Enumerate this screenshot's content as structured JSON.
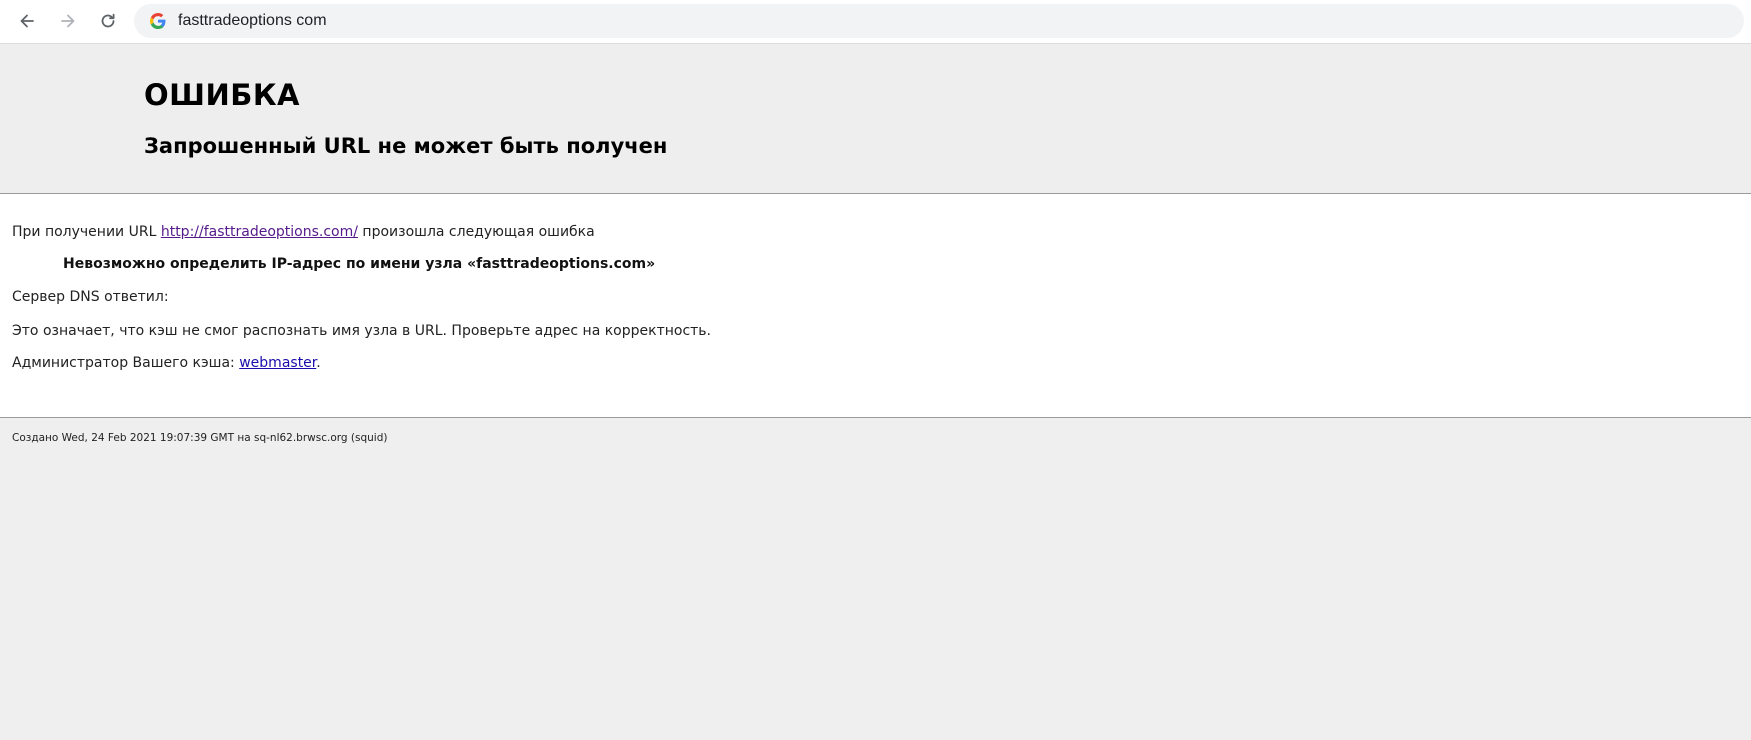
{
  "browser": {
    "address_bar": {
      "url_display": "fasttradeoptions com"
    },
    "icons": {
      "back": "arrow-left-icon",
      "forward": "arrow-right-icon",
      "reload": "reload-icon",
      "site": "google-g-icon"
    }
  },
  "page": {
    "title": "ОШИБКА",
    "subtitle": "Запрошенный URL не может быть получен",
    "intro_before": "При получении URL",
    "intro_link": "http://fasttradeoptions.com/",
    "intro_after": "произошла следующая ошибка",
    "error_message": "Невозможно определить IP-адрес по имени узла «fasttradeoptions.com»",
    "dns_reply": "Сервер DNS ответил:",
    "explanation": "Это означает, что кэш не смог распознать имя узла в URL. Проверьте адрес на корректность.",
    "admin_before": "Администратор Вашего кэша:",
    "admin_link": "webmaster",
    "admin_after": ".",
    "footer": "Создано Wed, 24 Feb 2021 19:07:39 GMT на sq-nl62.brwsc.org (squid)"
  },
  "colors": {
    "visited_link": "#551a8b",
    "link": "#1a0dab",
    "header_bg": "#eeeeee",
    "content_bg": "#ffffff"
  }
}
